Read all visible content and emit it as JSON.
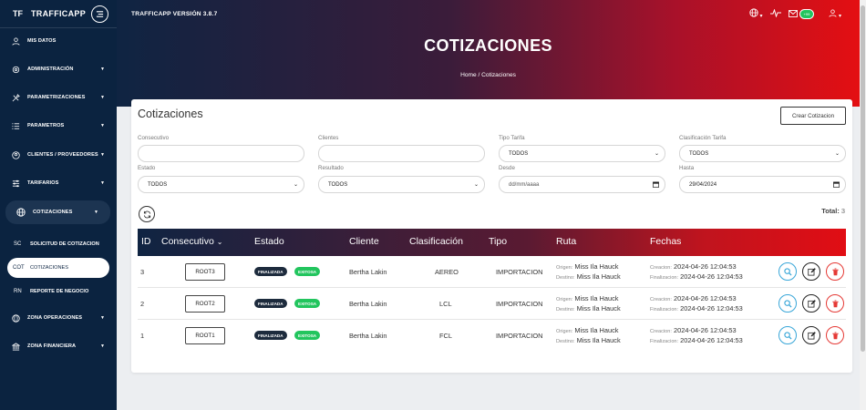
{
  "brand": {
    "abbr": "TF",
    "name": "TRAFFICAPP"
  },
  "sidebar": {
    "items": [
      {
        "label": "MIS DATOS",
        "icon": "user-icon",
        "has_chevron": false
      },
      {
        "label": "ADMINISTRACIÓN",
        "icon": "gear-icon",
        "has_chevron": true
      },
      {
        "label": "PARAMETRIZACIONES",
        "icon": "tools-icon",
        "has_chevron": true
      },
      {
        "label": "PARAMETROS",
        "icon": "list-icon",
        "has_chevron": true
      },
      {
        "label": "CLIENTES / PROVEEDORES",
        "icon": "user-circle-icon",
        "has_chevron": true
      },
      {
        "label": "TARIFARIOS",
        "icon": "sliders-icon",
        "has_chevron": true
      },
      {
        "label": "COTIZACIONES",
        "icon": "globe-icon",
        "has_chevron": true,
        "expanded": true
      }
    ],
    "subitems": [
      {
        "abbr": "SC",
        "label": "SOLICITUD DE COTIZACION"
      },
      {
        "abbr": "COT",
        "label": "COTIZACIONES",
        "active": true
      },
      {
        "abbr": "RN",
        "label": "REPORTE DE NEGOCIO"
      }
    ],
    "bottom_items": [
      {
        "label": "ZONA OPERACIONES",
        "icon": "globe-icon"
      },
      {
        "label": "ZONA FINANCIERA",
        "icon": "bank-icon"
      }
    ]
  },
  "header": {
    "version": "TRAFFICAPP VERSIÓN 3.8.7",
    "title": "COTIZACIONES",
    "breadcrumb": "Home / Cotizaciones",
    "mail_badge": "+99"
  },
  "card": {
    "title": "Cotizaciones",
    "create_button": "Crear Cotizacion",
    "filters": {
      "consecutivo": {
        "label": "Consecutivo",
        "value": ""
      },
      "clientes": {
        "label": "Clientes",
        "value": ""
      },
      "tipo_tarifa": {
        "label": "Tipo Tarifa",
        "value": "TODOS"
      },
      "clasificacion_tarifa": {
        "label": "Clasificación Tarifa",
        "value": "TODOS"
      },
      "estado": {
        "label": "Estado",
        "value": "TODOS"
      },
      "resultado": {
        "label": "Resultado",
        "value": "TODOS"
      },
      "desde": {
        "label": "Desde",
        "placeholder": "dd/mm/aaaa"
      },
      "hasta": {
        "label": "Hasta",
        "value": "29/04/2024"
      }
    },
    "total_label": "Total:",
    "total_value": "3"
  },
  "table": {
    "headers": {
      "id": "ID",
      "consecutivo": "Consecutivo",
      "estado": "Estado",
      "cliente": "Cliente",
      "clasificacion": "Clasificación",
      "tipo": "Tipo",
      "ruta": "Ruta",
      "fechas": "Fechas"
    },
    "labels": {
      "origen": "Origen:",
      "destino": "Destino:",
      "creacion": "Creacion:",
      "finalizacion": "Finalizacion:"
    },
    "rows": [
      {
        "id": "3",
        "consecutivo": "ROOT3",
        "estado": "FINALIZADA",
        "resultado": "EXITOSA",
        "cliente": "Bertha Lakin",
        "clasificacion": "AEREO",
        "tipo": "IMPORTACION",
        "origen": "Miss Ila Hauck",
        "destino": "Miss Ila Hauck",
        "creacion": "2024-04-26 12:04:53",
        "finalizacion": "2024-04-26 12:04:53"
      },
      {
        "id": "2",
        "consecutivo": "ROOT2",
        "estado": "FINALIZADA",
        "resultado": "EXITOSA",
        "cliente": "Bertha Lakin",
        "clasificacion": "LCL",
        "tipo": "IMPORTACION",
        "origen": "Miss Ila Hauck",
        "destino": "Miss Ila Hauck",
        "creacion": "2024-04-26 12:04:53",
        "finalizacion": "2024-04-26 12:04:53"
      },
      {
        "id": "1",
        "consecutivo": "ROOT1",
        "estado": "FINALIZADA",
        "resultado": "EXITOSA",
        "cliente": "Bertha Lakin",
        "clasificacion": "FCL",
        "tipo": "IMPORTACION",
        "origen": "Miss Ila Hauck",
        "destino": "Miss Ila Hauck",
        "creacion": "2024-04-26 12:04:53",
        "finalizacion": "2024-04-26 12:04:53"
      }
    ]
  },
  "colors": {
    "sidebar_bg": "#0b2340",
    "accent_red": "#e40f12",
    "success": "#22c55e",
    "view": "#38a6d8",
    "delete": "#e53935"
  }
}
